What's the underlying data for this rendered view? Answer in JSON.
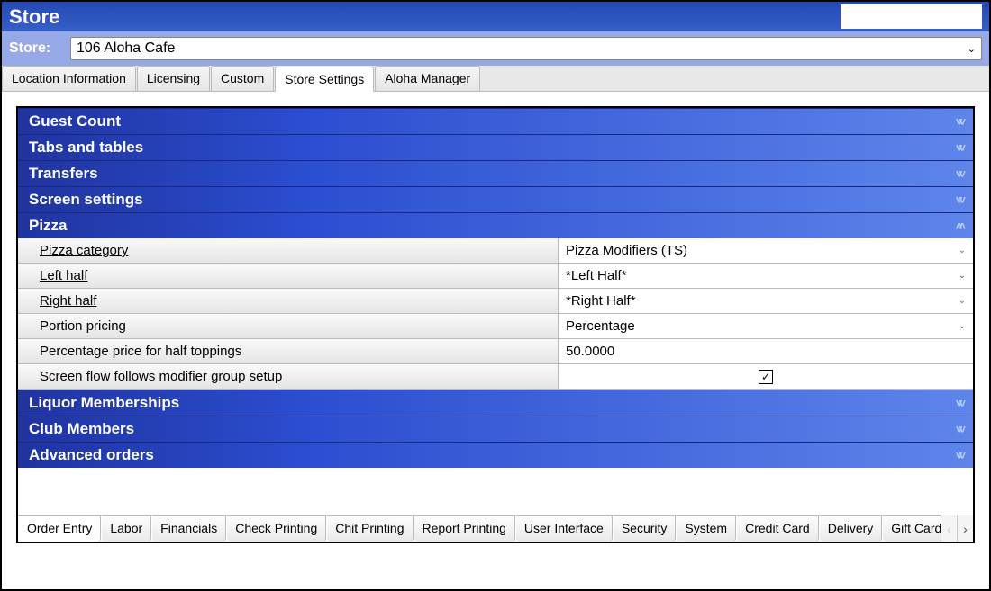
{
  "titlebar": {
    "title": "Store"
  },
  "store_row": {
    "label": "Store:",
    "value": "106 Aloha Cafe"
  },
  "top_tabs": [
    {
      "label": "Location Information",
      "active": false
    },
    {
      "label": "Licensing",
      "active": false
    },
    {
      "label": "Custom",
      "active": false
    },
    {
      "label": "Store Settings",
      "active": true
    },
    {
      "label": "Aloha Manager",
      "active": false
    }
  ],
  "accordion": {
    "guest_count": "Guest Count",
    "tabs_tables": "Tabs and tables",
    "transfers": "Transfers",
    "screen_settings": "Screen settings",
    "pizza": "Pizza",
    "liquor": "Liquor Memberships",
    "club": "Club Members",
    "advanced": "Advanced orders"
  },
  "pizza_props": {
    "category": {
      "label": "Pizza category",
      "value": "Pizza Modifiers (TS)"
    },
    "left_half": {
      "label": "Left half",
      "value": "*Left Half*"
    },
    "right_half": {
      "label": "Right half",
      "value": "*Right Half*"
    },
    "portion_pricing": {
      "label": "Portion pricing",
      "value": "Percentage"
    },
    "pct_price": {
      "label": "Percentage price for half toppings",
      "value": "50.0000"
    },
    "screen_flow": {
      "label": "Screen flow follows modifier group setup",
      "checked": true
    }
  },
  "bottom_tabs": [
    "Order Entry",
    "Labor",
    "Financials",
    "Check Printing",
    "Chit Printing",
    "Report Printing",
    "User Interface",
    "Security",
    "System",
    "Credit Card",
    "Delivery",
    "Gift Card"
  ]
}
